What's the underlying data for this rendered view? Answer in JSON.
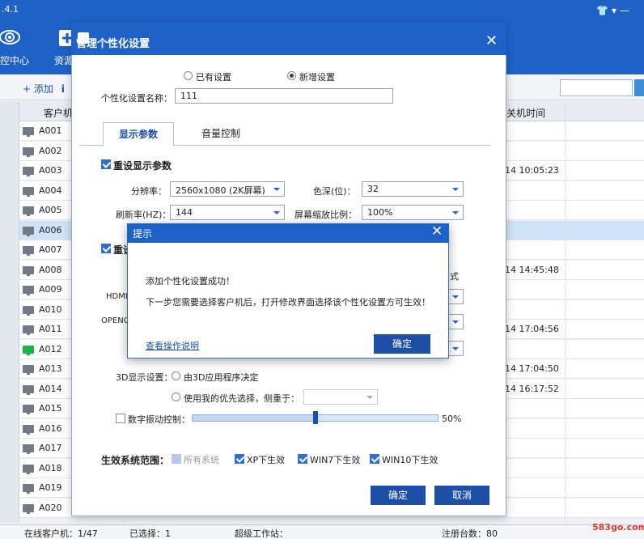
{
  "app": {
    "version": ".4.1",
    "nav": [
      {
        "label": "控中心",
        "icon": "eye-icon"
      },
      {
        "label": "资源",
        "icon": "add-resource-icon"
      },
      {
        "label": "",
        "icon": "monitor-icon"
      },
      {
        "label": "",
        "icon": "network-icon"
      },
      {
        "label": "",
        "icon": "briefcase-icon"
      },
      {
        "label": "",
        "icon": "minus-icon"
      }
    ],
    "window_controls": [
      "shirt-icon",
      "chevron-down-icon",
      "minimize-icon"
    ]
  },
  "toolbar": {
    "add_label": "+ 添加",
    "info_label": "i"
  },
  "table": {
    "col_client": "客户机名",
    "col_shutdown": "关机时间",
    "rows": [
      {
        "id": "A001",
        "time": "",
        "online": false
      },
      {
        "id": "A002",
        "time": "",
        "online": false
      },
      {
        "id": "A003",
        "time": "-14 10:05:23",
        "online": false
      },
      {
        "id": "A004",
        "time": "",
        "online": false
      },
      {
        "id": "A005",
        "time": "",
        "online": false
      },
      {
        "id": "A006",
        "time": "",
        "online": false,
        "selected": true
      },
      {
        "id": "A007",
        "time": "",
        "online": false
      },
      {
        "id": "A008",
        "time": "-14 14:45:48",
        "online": false
      },
      {
        "id": "A009",
        "time": "",
        "online": false
      },
      {
        "id": "A010",
        "time": "",
        "online": false
      },
      {
        "id": "A011",
        "time": "-14 17:04:56",
        "online": false
      },
      {
        "id": "A012",
        "time": "",
        "online": true
      },
      {
        "id": "A013",
        "time": "-14 17:04:50",
        "online": false
      },
      {
        "id": "A014",
        "time": "-14 16:17:52",
        "online": false
      },
      {
        "id": "A015",
        "time": "",
        "online": false
      },
      {
        "id": "A016",
        "time": "",
        "online": false
      },
      {
        "id": "A017",
        "time": "",
        "online": false
      },
      {
        "id": "A018",
        "time": "",
        "online": false
      },
      {
        "id": "A019",
        "time": "",
        "online": false
      },
      {
        "id": "A020",
        "time": "",
        "online": false
      }
    ]
  },
  "status": {
    "online": "在线客户机：1/47",
    "selected": "已选择：1",
    "super_ws": "超级工作站：",
    "registered": "注册台数：80"
  },
  "watermark": "583go.com",
  "dialog": {
    "title": "管理个性化设置",
    "radio_existing": "已有设置",
    "radio_new": "新增设置",
    "name_label": "个性化设置名称：",
    "name_value": "111",
    "tab_display": "显示参数",
    "tab_volume": "音量控制",
    "reset_display": "重设显示参数",
    "resolution_label": "分辨率：",
    "resolution_value": "2560x1080 (2K屏幕)",
    "color_label": "色深(位)：",
    "color_value": "32",
    "refresh_label": "刷新率(HZ)：",
    "refresh_value": "144",
    "scale_label": "屏幕缩放比例：",
    "scale_value": "100%",
    "reset2_label": "重设",
    "hdmi_label": "HDMI",
    "opengl_label": "OPENGL",
    "mode_tail": "式",
    "label_3d": "3D显示设置：",
    "opt_app": "由3D应用程序决定",
    "opt_pref": "使用我的优先选择，侧重于：",
    "vibrance_label": "数字振动控制：",
    "vibrance_value": "50%",
    "scope_label": "生效系统范围：",
    "scope_all": "所有系统",
    "scope_xp": "XP下生效",
    "scope_win7": "WIN7下生效",
    "scope_win10": "WIN10下生效",
    "ok": "确定",
    "cancel": "取消",
    "vibrance_percent": 50
  },
  "prompt": {
    "title": "提示",
    "line1": "添加个性化设置成功！",
    "line2": "下一步您需要选择客户机后，打开修改界面选择该个性化设置方可生效！",
    "link": "查看操作说明",
    "ok": "确定"
  }
}
